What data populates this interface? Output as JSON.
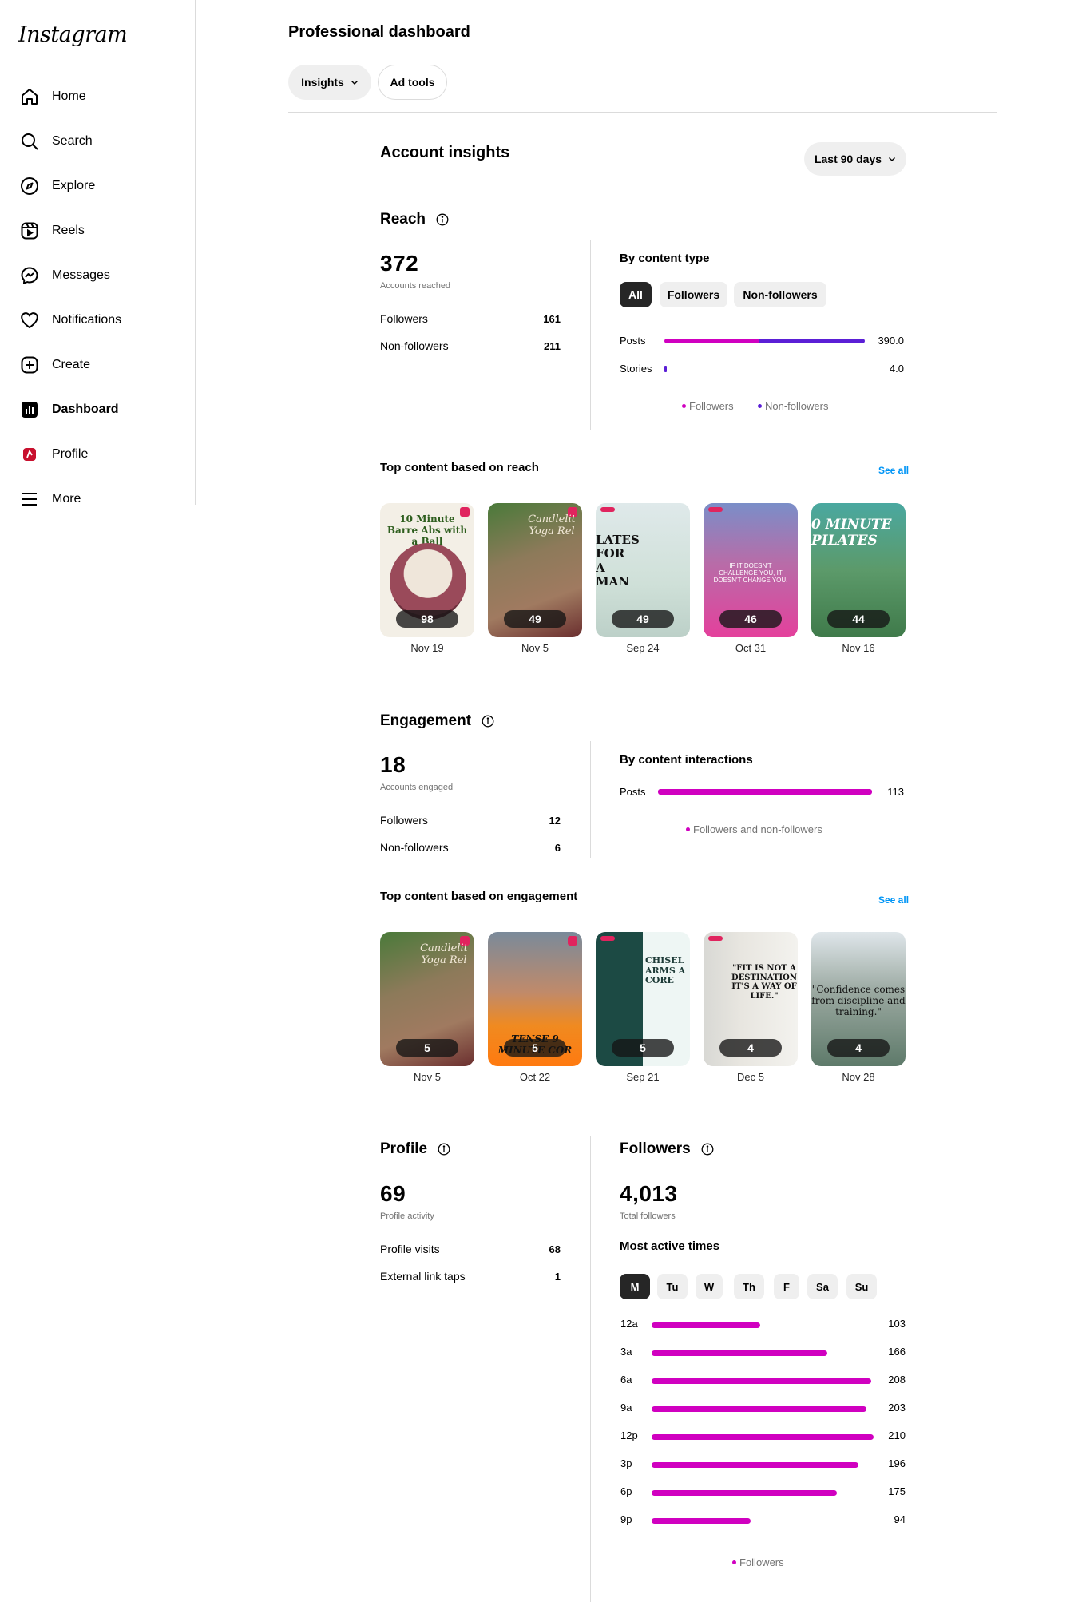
{
  "app": {
    "logo": "Instagram"
  },
  "sidebar": {
    "items": [
      {
        "label": "Home",
        "icon": "home-icon"
      },
      {
        "label": "Search",
        "icon": "search-icon"
      },
      {
        "label": "Explore",
        "icon": "compass-icon"
      },
      {
        "label": "Reels",
        "icon": "reels-icon"
      },
      {
        "label": "Messages",
        "icon": "messenger-icon"
      },
      {
        "label": "Notifications",
        "icon": "heart-icon"
      },
      {
        "label": "Create",
        "icon": "plus-square-icon"
      },
      {
        "label": "Dashboard",
        "icon": "dashboard-icon",
        "active": true
      },
      {
        "label": "Profile",
        "icon": "avatar-icon"
      },
      {
        "label": "More",
        "icon": "hamburger-icon"
      }
    ]
  },
  "header": {
    "title": "Professional dashboard",
    "tabs": [
      {
        "label": "Insights"
      },
      {
        "label": "Ad tools"
      }
    ]
  },
  "insights": {
    "title": "Account insights",
    "range": "Last 90 days"
  },
  "reach": {
    "title": "Reach",
    "total": "372",
    "total_label": "Accounts reached",
    "rows": [
      {
        "label": "Followers",
        "value": "161"
      },
      {
        "label": "Non-followers",
        "value": "211"
      }
    ],
    "by_type_title": "By content type",
    "filters": [
      "All",
      "Followers",
      "Non-followers"
    ],
    "bars": [
      {
        "label": "Posts",
        "value_text": "390.0",
        "followers": 0.47,
        "non_followers": 0.53,
        "fraction": 1.0
      },
      {
        "label": "Stories",
        "value_text": "4.0",
        "followers": 0.0,
        "non_followers": 1.0,
        "fraction": 0.0103
      }
    ],
    "legend": [
      "Followers",
      "Non-followers"
    ]
  },
  "top_reach": {
    "title": "Top content based on reach",
    "see_all": "See all",
    "items": [
      {
        "count": "98",
        "date": "Nov 19",
        "caption": "10 Minute Barre Abs with a Ball"
      },
      {
        "count": "49",
        "date": "Nov 5",
        "caption": "Candlelit Yoga Rel"
      },
      {
        "count": "49",
        "date": "Sep 24",
        "caption": "LATES FOR A MAN"
      },
      {
        "count": "46",
        "date": "Oct 31",
        "caption": "IF IT DOESN'T CHALLENGE YOU, IT DOESN'T CHANGE YOU."
      },
      {
        "count": "44",
        "date": "Nov 16",
        "caption": "0 MINUTE PILATES"
      }
    ]
  },
  "engagement": {
    "title": "Engagement",
    "total": "18",
    "total_label": "Accounts engaged",
    "rows": [
      {
        "label": "Followers",
        "value": "12"
      },
      {
        "label": "Non-followers",
        "value": "6"
      }
    ],
    "by_interactions_title": "By content interactions",
    "bars": [
      {
        "label": "Posts",
        "value_text": "113",
        "fraction": 1.0
      }
    ],
    "legend": [
      "Followers and non-followers"
    ]
  },
  "top_engagement": {
    "title": "Top content based on engagement",
    "see_all": "See all",
    "items": [
      {
        "count": "5",
        "date": "Nov 5",
        "caption": "Candlelit Yoga Rel"
      },
      {
        "count": "5",
        "date": "Oct 22",
        "caption": "TENSE 9 MINUTE COR"
      },
      {
        "count": "5",
        "date": "Sep 21",
        "caption": "CHISEL ARMS A CORE"
      },
      {
        "count": "4",
        "date": "Dec 5",
        "caption": "\"FIT IS NOT A DESTINATION IT'S A WAY OF LIFE.\""
      },
      {
        "count": "4",
        "date": "Nov 28",
        "caption": "\"Confidence comes from discipline and training.\""
      }
    ]
  },
  "profile": {
    "title": "Profile",
    "total": "69",
    "total_label": "Profile activity",
    "rows": [
      {
        "label": "Profile visits",
        "value": "68"
      },
      {
        "label": "External link taps",
        "value": "1"
      }
    ]
  },
  "followers": {
    "title": "Followers",
    "total": "4,013",
    "total_label": "Total followers",
    "active_title": "Most active times",
    "days": [
      "M",
      "Tu",
      "W",
      "Th",
      "F",
      "Sa",
      "Su"
    ],
    "selected_day": "M",
    "hours": [
      {
        "label": "12a",
        "value": 103
      },
      {
        "label": "3a",
        "value": 166
      },
      {
        "label": "6a",
        "value": 208
      },
      {
        "label": "9a",
        "value": 203
      },
      {
        "label": "12p",
        "value": 210
      },
      {
        "label": "3p",
        "value": 196
      },
      {
        "label": "6p",
        "value": 175
      },
      {
        "label": "9p",
        "value": 94
      }
    ],
    "legend": [
      "Followers"
    ]
  },
  "colors": {
    "followers": "#d000c0",
    "non_followers": "#5b1fd6",
    "link": "#0095f6"
  }
}
